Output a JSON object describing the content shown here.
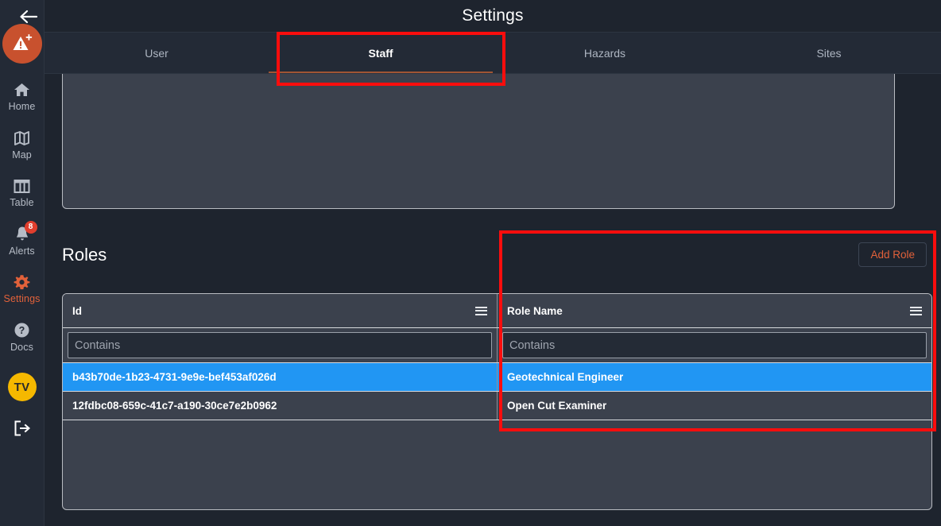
{
  "header": {
    "title": "Settings",
    "back_icon": "arrow-left-icon"
  },
  "sidebar": {
    "logo_icon": "hazard-add-logo",
    "items": [
      {
        "label": "Home",
        "icon": "home-icon",
        "active": false,
        "badge": ""
      },
      {
        "label": "Map",
        "icon": "map-icon",
        "active": false,
        "badge": ""
      },
      {
        "label": "Table",
        "icon": "table-icon",
        "active": false,
        "badge": ""
      },
      {
        "label": "Alerts",
        "icon": "bell-icon",
        "active": false,
        "badge": "8"
      },
      {
        "label": "Settings",
        "icon": "gear-icon",
        "active": true,
        "badge": ""
      },
      {
        "label": "Docs",
        "icon": "help-icon",
        "active": false,
        "badge": ""
      }
    ],
    "avatar": {
      "initials": "TV"
    },
    "logout_icon": "logout-icon"
  },
  "tabs": [
    {
      "label": "User",
      "active": false
    },
    {
      "label": "Staff",
      "active": true
    },
    {
      "label": "Hazards",
      "active": false
    },
    {
      "label": "Sites",
      "active": false
    }
  ],
  "roles_section": {
    "title": "Roles",
    "add_button": "Add Role"
  },
  "roles_grid": {
    "columns": [
      {
        "label": "Id",
        "menu_icon": "hamburger-icon",
        "filter_placeholder": "Contains"
      },
      {
        "label": "Role Name",
        "menu_icon": "hamburger-icon",
        "filter_placeholder": "Contains"
      }
    ],
    "rows": [
      {
        "id": "b43b70de-1b23-4731-9e9e-bef453af026d",
        "role_name": "Geotechnical Engineer",
        "selected": true
      },
      {
        "id": "12fdbc08-659c-41c7-a190-30ce7e2b0962",
        "role_name": "Open Cut Examiner",
        "selected": false
      }
    ]
  },
  "colors": {
    "accent": "#e2613a",
    "selection": "#2196f3",
    "annotation": "#fb0d0d",
    "sidebar_bg": "#232a36",
    "page_bg": "#1e242e",
    "panel_bg": "#3b414d",
    "avatar_bg": "#f5b800",
    "badge_bg": "#e03e2d"
  },
  "annotations": [
    {
      "name": "staff-tab-highlight"
    },
    {
      "name": "roles-table-highlight"
    }
  ]
}
